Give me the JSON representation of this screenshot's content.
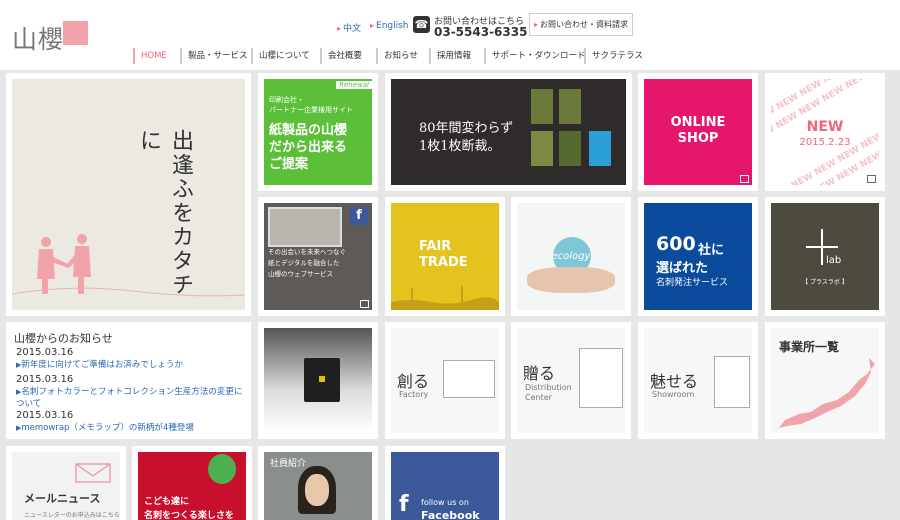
{
  "header": {
    "logo": "山櫻",
    "lang_zh": "中文",
    "lang_en": "English",
    "tel_label": "お問い合わせはこちら",
    "tel_number": "03-5543-6335",
    "contact_button": "お問い合わせ・資料請求"
  },
  "nav": [
    "HOME",
    "製品・サービス",
    "山櫻について",
    "会社概要",
    "お知らせ",
    "採用情報",
    "サポート・ダウンロード",
    "サクラテラス"
  ],
  "tiles": {
    "hero_text": "出逢ふをカタチに",
    "paper_badge": "Renewal",
    "paper_small1": "印刷会社・",
    "paper_small2": "パートナー企業様用サイト",
    "paper_big1": "紙製品の山櫻",
    "paper_big2": "だから出来る",
    "paper_big3": "ご提案",
    "nameplate_line1": "80年間変わらず",
    "nameplate_line2": "1枚1枚断裁。",
    "shop_line1": "ONLINE",
    "shop_line2": "SHOP",
    "new_label": "NEW",
    "new_date": "2015.2.23",
    "web_line1": "その出会いを未来へつなぐ",
    "web_line2": "紙とデジタルを融合した",
    "web_line3": "山櫻のウェブサービス",
    "fair1": "FAIR",
    "fair2": "TRADE",
    "ecology": "ecology",
    "count_num": "600",
    "count_suffix": "社に",
    "count_line2": "選ばれた",
    "count_line3": "名刺発注サービス",
    "lab_label": "lab",
    "lab_sub": "【 プラスラボ 】",
    "factory_jp": "創る",
    "factory_en": "Factory",
    "dist_jp": "贈る",
    "dist_en1": "Distribution",
    "dist_en2": "Center",
    "show_jp": "魅せる",
    "show_en": "Showroom",
    "offices": "事業所一覧",
    "mail_title": "メールニュース",
    "mail_sub": "ニュースレターのお申込みはこちら",
    "kids_line1": "こども達に",
    "kids_line2": "名刺をつくる楽しさを",
    "staff": "社員紹介",
    "fb_line1": "follow us on",
    "fb_line2": "Facebook"
  },
  "news": {
    "title": "山櫻からのお知らせ",
    "items": [
      {
        "date": "2015.03.16",
        "text": "新年度に向けてご準備はお済みでしょうか"
      },
      {
        "date": "2015.03.16",
        "text": "名刺フォトカラーとフォトコレクション生産方法の変更について"
      },
      {
        "date": "2015.03.16",
        "text": "memowrap（メモラップ）の新柄が4種登場"
      }
    ]
  },
  "colors": {
    "accent_pink": "#f0a3a8",
    "link_blue": "#2a67b5",
    "shop_pink": "#e5166b",
    "paper_green": "#5cbf3a",
    "fb_blue": "#3b5998"
  }
}
